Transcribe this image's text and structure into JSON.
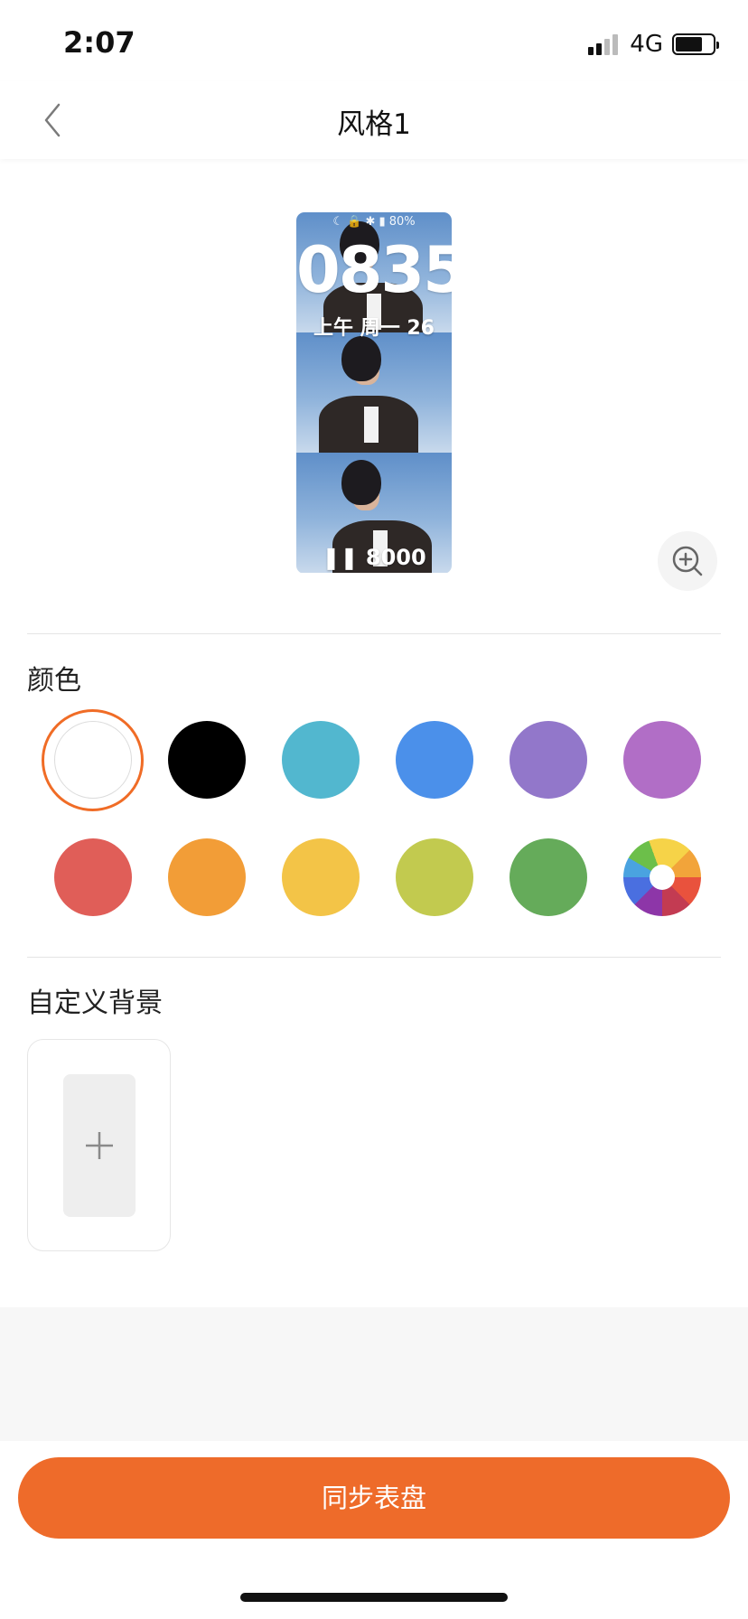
{
  "status_bar": {
    "time": "2:07",
    "network": "4G"
  },
  "nav": {
    "title": "风格1",
    "back_icon": "chevron-left-icon"
  },
  "preview": {
    "status_icons": "☾ 🔒 ✱ ▮ 80%",
    "time": "0835",
    "date": "上午 周一 26",
    "steps": "8000",
    "zoom_icon": "zoom-in-icon"
  },
  "colors": {
    "title": "颜色",
    "selected_index": 0,
    "accent": "#f06c26",
    "swatches": [
      "#ffffff",
      "#000000",
      "#52b7cf",
      "#4b90ea",
      "#9277ca",
      "#b16ec6",
      "#e05e58",
      "#f29d37",
      "#f3c447",
      "#c2ca4f",
      "#65ab5a",
      "color-wheel"
    ]
  },
  "custom_background": {
    "title": "自定义背景",
    "add_icon": "plus-icon"
  },
  "sync_button": {
    "label": "同步表盘",
    "color": "#ee6b2a"
  }
}
